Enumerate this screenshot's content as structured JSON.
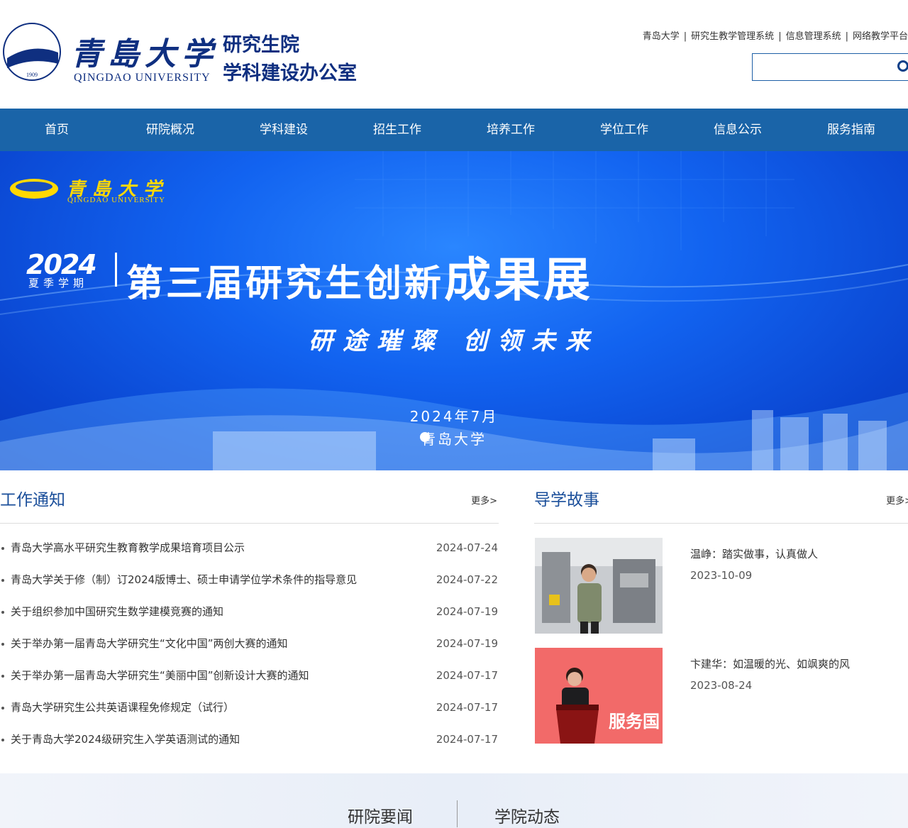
{
  "header": {
    "university_cn": "青島大学",
    "university_en": "QINGDAO UNIVERSITY",
    "seal_year": "1909",
    "dept_line1": "研究生院",
    "dept_line2": "学科建设办公室",
    "toplinks": [
      "青岛大学",
      "研究生教学管理系统",
      "信息管理系统",
      "网络教学平台"
    ],
    "search_placeholder": ""
  },
  "nav": [
    "首页",
    "研院概况",
    "学科建设",
    "招生工作",
    "培养工作",
    "学位工作",
    "信息公示",
    "服务指南"
  ],
  "banner": {
    "logo_cn": "青島大学",
    "logo_en": "QINGDAO UNIVERSITY",
    "year": "2024",
    "term": "夏季学期",
    "title_main": "第三届研究生创新",
    "title_big": "成果展",
    "slogan": "研途璀璨    创领未来",
    "date": "2024年7月",
    "place": "青岛大学"
  },
  "notices": {
    "title": "工作通知",
    "more": "更多>",
    "items": [
      {
        "title": "青岛大学高水平研究生教育教学成果培育项目公示",
        "date": "2024-07-24"
      },
      {
        "title": "青岛大学关于修（制）订2024版博士、硕士申请学位学术条件的指导意见",
        "date": "2024-07-22"
      },
      {
        "title": "关于组织参加中国研究生数学建模竞赛的通知",
        "date": "2024-07-19"
      },
      {
        "title": "关于举办第一届青岛大学研究生“文化中国”两创大赛的通知",
        "date": "2024-07-19"
      },
      {
        "title": "关于举办第一届青岛大学研究生“美丽中国”创新设计大赛的通知",
        "date": "2024-07-17"
      },
      {
        "title": "青岛大学研究生公共英语课程免修规定（试行）",
        "date": "2024-07-17"
      },
      {
        "title": "关于青岛大学2024级研究生入学英语测试的通知",
        "date": "2024-07-17"
      }
    ]
  },
  "stories": {
    "title": "导学故事",
    "more": "更多>",
    "items": [
      {
        "title": "温峥：踏实做事，认真做人",
        "date": "2023-10-09"
      },
      {
        "title": "卞建华：如温暖的光、如飒爽的风",
        "date": "2023-08-24"
      }
    ],
    "photo2_sign": "服务国"
  },
  "bottom_tabs": [
    "研院要闻",
    "学院动态"
  ]
}
